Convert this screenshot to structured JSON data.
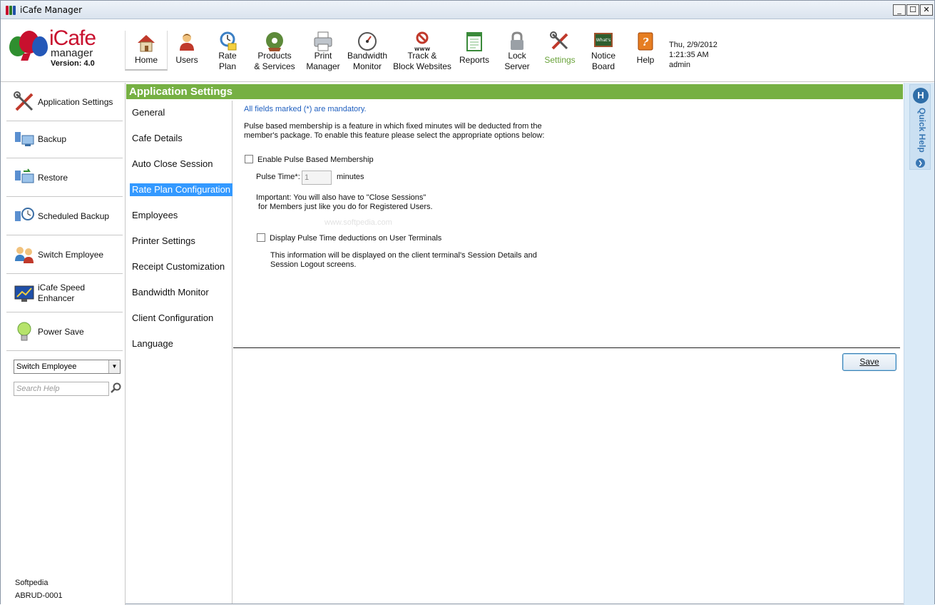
{
  "window": {
    "title": "iCafe Manager",
    "minimize_label": "_",
    "maximize_label": "☐",
    "close_label": "✕"
  },
  "logo": {
    "word": "iCafe",
    "sub": "manager",
    "version": "Version: 4.0"
  },
  "toolbar": {
    "items": [
      {
        "label": "Home",
        "icon": "home-icon"
      },
      {
        "label": "Users",
        "icon": "user-icon"
      },
      {
        "label": "Rate\nPlan",
        "icon": "rate-plan-icon"
      },
      {
        "label": "Products\n& Services",
        "icon": "products-disc-icon"
      },
      {
        "label": "Print\nManager",
        "icon": "printer-icon"
      },
      {
        "label": "Bandwidth\nMonitor",
        "icon": "gauge-icon"
      },
      {
        "label": "Track &\nBlock Websites",
        "icon": "block-www-icon"
      },
      {
        "label": "Reports",
        "icon": "reports-icon"
      },
      {
        "label": "Lock\nServer",
        "icon": "lock-icon"
      },
      {
        "label": "Settings",
        "icon": "settings-tools-icon"
      },
      {
        "label": "Notice\nBoard",
        "icon": "notice-board-icon"
      },
      {
        "label": "Help",
        "icon": "help-book-icon"
      }
    ],
    "active_color": "#6aa33b"
  },
  "datetime": {
    "date": "Thu, 2/9/2012",
    "time": "1:21:35 AM",
    "user": "admin"
  },
  "sidebar": {
    "items": [
      {
        "label": "Application Settings",
        "icon": "tools-icon"
      },
      {
        "label": "Backup",
        "icon": "backup-icon"
      },
      {
        "label": "Restore",
        "icon": "restore-icon"
      },
      {
        "label": "Scheduled Backup",
        "icon": "scheduled-backup-icon"
      },
      {
        "label": "Switch Employee",
        "icon": "switch-employee-icon"
      },
      {
        "label": "iCafe Speed Enhancer",
        "icon": "speed-enhancer-icon"
      },
      {
        "label": "Power Save",
        "icon": "lightbulb-icon"
      }
    ],
    "select_value": "Switch Employee",
    "search_placeholder": "Search Help",
    "footer_line1": "Softpedia",
    "footer_line2": "ABRUD-0001"
  },
  "main": {
    "header": "Application Settings",
    "header_color": "#76b043",
    "subnav": [
      "General",
      "Cafe Details",
      "Auto Close Session",
      "Rate Plan Configuration",
      "Employees",
      "Printer Settings",
      "Receipt Customization",
      "Bandwidth Monitor",
      "Client Configuration",
      "Language"
    ],
    "active_subnav": "Rate Plan Configuration"
  },
  "form": {
    "mandatory_note": "All fields marked (*) are mandatory.",
    "description": "Pulse based membership is a feature in which fixed minutes will be deducted from the member's package. To enable this feature please select the appropriate options below:",
    "enable_label": "Enable Pulse Based Membership",
    "enable_checked": false,
    "pulse_time_label": "Pulse Time*:",
    "pulse_time_value": "1",
    "pulse_time_unit": "minutes",
    "important_line1": "Important:  You will also have to \"Close Sessions\"",
    "important_line2": " for Members just like you do for Registered Users.",
    "display_label": "Display Pulse Time deductions on User Terminals",
    "display_checked": false,
    "info_line1": "This information will be displayed on the client terminal's Session Details and",
    "info_line2": "Session Logout screens.",
    "watermark": "www.softpedia.com",
    "save_label": "Save"
  },
  "quick_help": {
    "label": "Quick Help",
    "badge": "H",
    "arrow": "❯"
  }
}
